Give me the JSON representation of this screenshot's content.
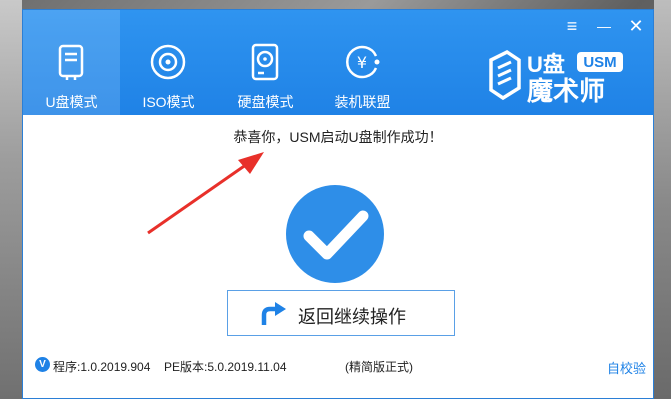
{
  "tabs": [
    {
      "label": "U盘模式",
      "icon": "usb-drive-icon",
      "active": true
    },
    {
      "label": "ISO模式",
      "icon": "disc-icon",
      "active": false
    },
    {
      "label": "硬盘模式",
      "icon": "hard-disk-icon",
      "active": false
    },
    {
      "label": "装机联盟",
      "icon": "yen-coin-icon",
      "active": false
    }
  ],
  "window_controls": {
    "menu": "≡",
    "minimize": "—",
    "close": "✕"
  },
  "logo": {
    "text_main": "U盘",
    "badge": "USM",
    "text_sub": "魔术师"
  },
  "message": "恭喜你，USM启动U盘制作成功！",
  "return_button": "返回继续操作",
  "footer": {
    "version_badge": "V",
    "program_version": "程序:1.0.2019.904",
    "pe_version": "PE版本:5.0.2019.11.04",
    "edition": "(精简版正式)",
    "verify_link": "自校验"
  },
  "colors": {
    "brand_blue": "#1f82e6",
    "arrow_red": "#e8302a"
  }
}
